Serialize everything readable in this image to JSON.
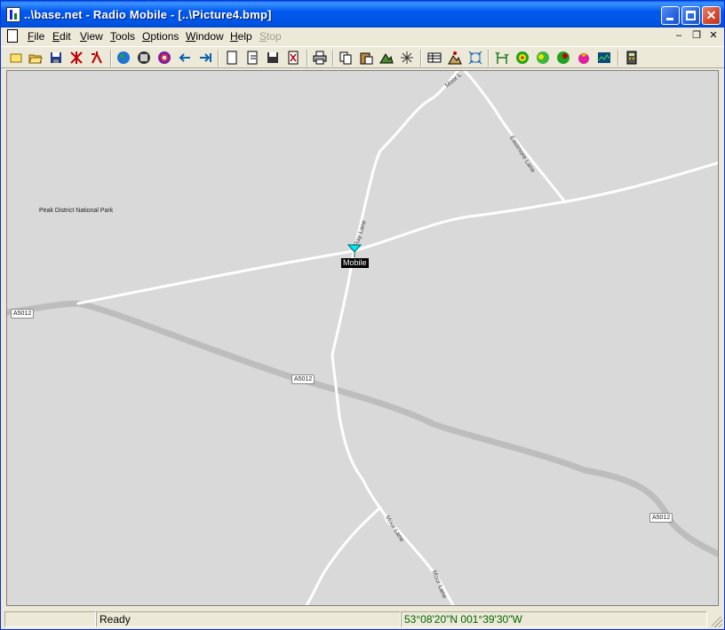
{
  "window": {
    "title": "..\\base.net - Radio Mobile - [..\\Picture4.bmp]"
  },
  "menu": {
    "items": [
      {
        "label": "File",
        "key": "F"
      },
      {
        "label": "Edit",
        "key": "E"
      },
      {
        "label": "View",
        "key": "V"
      },
      {
        "label": "Tools",
        "key": "T"
      },
      {
        "label": "Options",
        "key": "O"
      },
      {
        "label": "Window",
        "key": "W"
      },
      {
        "label": "Help",
        "key": "H"
      },
      {
        "label": "Stop",
        "key": "S",
        "disabled": true
      }
    ],
    "mdi_min": "–",
    "mdi_restore": "❐",
    "mdi_close": "✕"
  },
  "toolbar": {
    "icons": [
      "new-icon",
      "open-icon",
      "save-icon",
      "network-properties-icon",
      "unit-properties-icon",
      "world-map-icon",
      "map-properties-icon",
      "merge-pictures-icon",
      "previous-icon",
      "next-icon",
      "new-picture-icon",
      "open-picture-icon",
      "save-picture-icon",
      "pdf-icon",
      "print-icon",
      "copy-icon",
      "paste-icon",
      "edit-picture-icon",
      "resize-icon",
      "show-networks-icon",
      "unit-locations-icon",
      "fit-icon",
      "radio-link-icon",
      "polar-coverage-icon",
      "cartesian-coverage-icon",
      "combined-coverage-icon",
      "route-coverage-icon",
      "elevation-grid-icon",
      "calculator-icon"
    ]
  },
  "map": {
    "place_label": "Peak District National Park",
    "unit_label": "Mobile",
    "road_shield_left": "A5012",
    "road_shield_mid": "A5012",
    "road_shield_right": "A5012",
    "road_names": {
      "moor_top": "Moor L",
      "eastmore": "Eastmore Lane",
      "ray_lane": "Ray Lane",
      "moor_lane_1": "Moor Lane",
      "moor_lane_2": "Moor Lane"
    },
    "colors": {
      "background": "#D9D9D9",
      "road": "#FFFFFF",
      "main_road": "#BDBDBD",
      "unit": "#00E5EE"
    }
  },
  "status": {
    "message": "Ready",
    "coordinates": "53°08'20\"N 001°39'30\"W",
    "coord_color": "#006600"
  }
}
